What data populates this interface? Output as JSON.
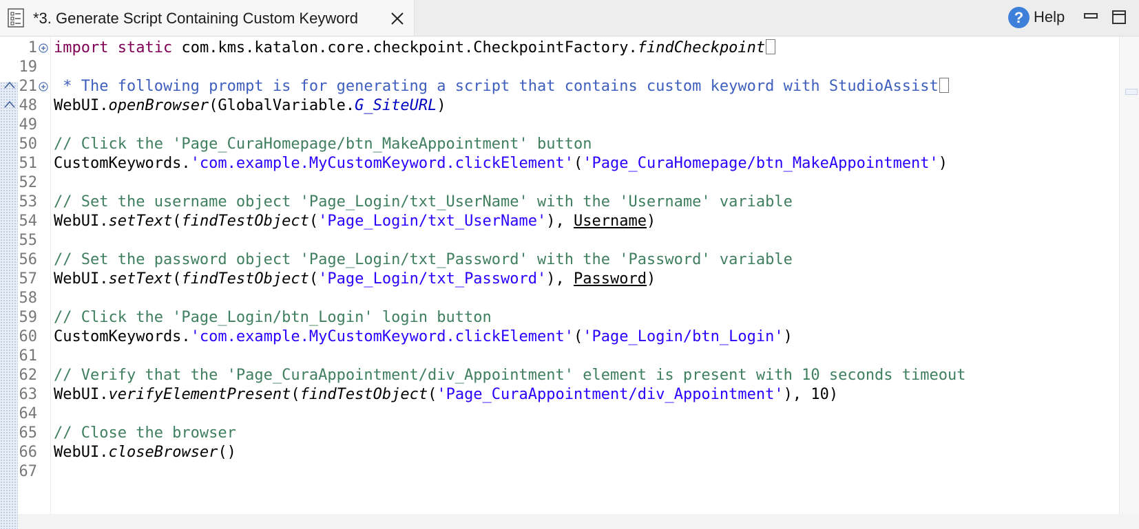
{
  "tab": {
    "title": "*3. Generate Script Containing Custom Keyword",
    "icon": "script-file-icon"
  },
  "toolbar": {
    "help_label": "Help",
    "help_icon_glyph": "?"
  },
  "editor": {
    "lines": [
      {
        "num": "1",
        "text": "import static com.kms.katalon.core.checkpoint.CheckpointFactory.findCheckpoint"
      },
      {
        "num": "19",
        "text": ""
      },
      {
        "num": "21",
        "text": " * The following prompt is for generating a script that contains custom keyword with StudioAssist"
      },
      {
        "num": "48",
        "text": "WebUI.openBrowser(GlobalVariable.G_SiteURL)"
      },
      {
        "num": "49",
        "text": ""
      },
      {
        "num": "50",
        "text": "// Click the 'Page_CuraHomepage/btn_MakeAppointment' button"
      },
      {
        "num": "51",
        "text": "CustomKeywords.'com.example.MyCustomKeyword.clickElement'('Page_CuraHomepage/btn_MakeAppointment')"
      },
      {
        "num": "52",
        "text": ""
      },
      {
        "num": "53",
        "text": "// Set the username object 'Page_Login/txt_UserName' with the 'Username' variable"
      },
      {
        "num": "54",
        "text": "WebUI.setText(findTestObject('Page_Login/txt_UserName'), Username)"
      },
      {
        "num": "55",
        "text": ""
      },
      {
        "num": "56",
        "text": "// Set the password object 'Page_Login/txt_Password' with the 'Password' variable"
      },
      {
        "num": "57",
        "text": "WebUI.setText(findTestObject('Page_Login/txt_Password'), Password)"
      },
      {
        "num": "58",
        "text": ""
      },
      {
        "num": "59",
        "text": "// Click the 'Page_Login/btn_Login' login button"
      },
      {
        "num": "60",
        "text": "CustomKeywords.'com.example.MyCustomKeyword.clickElement'('Page_Login/btn_Login')"
      },
      {
        "num": "61",
        "text": ""
      },
      {
        "num": "62",
        "text": "// Verify that the 'Page_CuraAppointment/div_Appointment' element is present with 10 seconds timeout"
      },
      {
        "num": "63",
        "text": "WebUI.verifyElementPresent(findTestObject('Page_CuraAppointment/div_Appointment'), 10)"
      },
      {
        "num": "64",
        "text": ""
      },
      {
        "num": "65",
        "text": "// Close the browser"
      },
      {
        "num": "66",
        "text": "WebUI.closeBrowser()"
      },
      {
        "num": "67",
        "text": ""
      }
    ]
  },
  "colors": {
    "keyword": "#7f0055",
    "comment": "#3f7f5f",
    "javadoc": "#3f5fbf",
    "string": "#2a00ff",
    "help_icon_bg": "#3d7fd9"
  }
}
